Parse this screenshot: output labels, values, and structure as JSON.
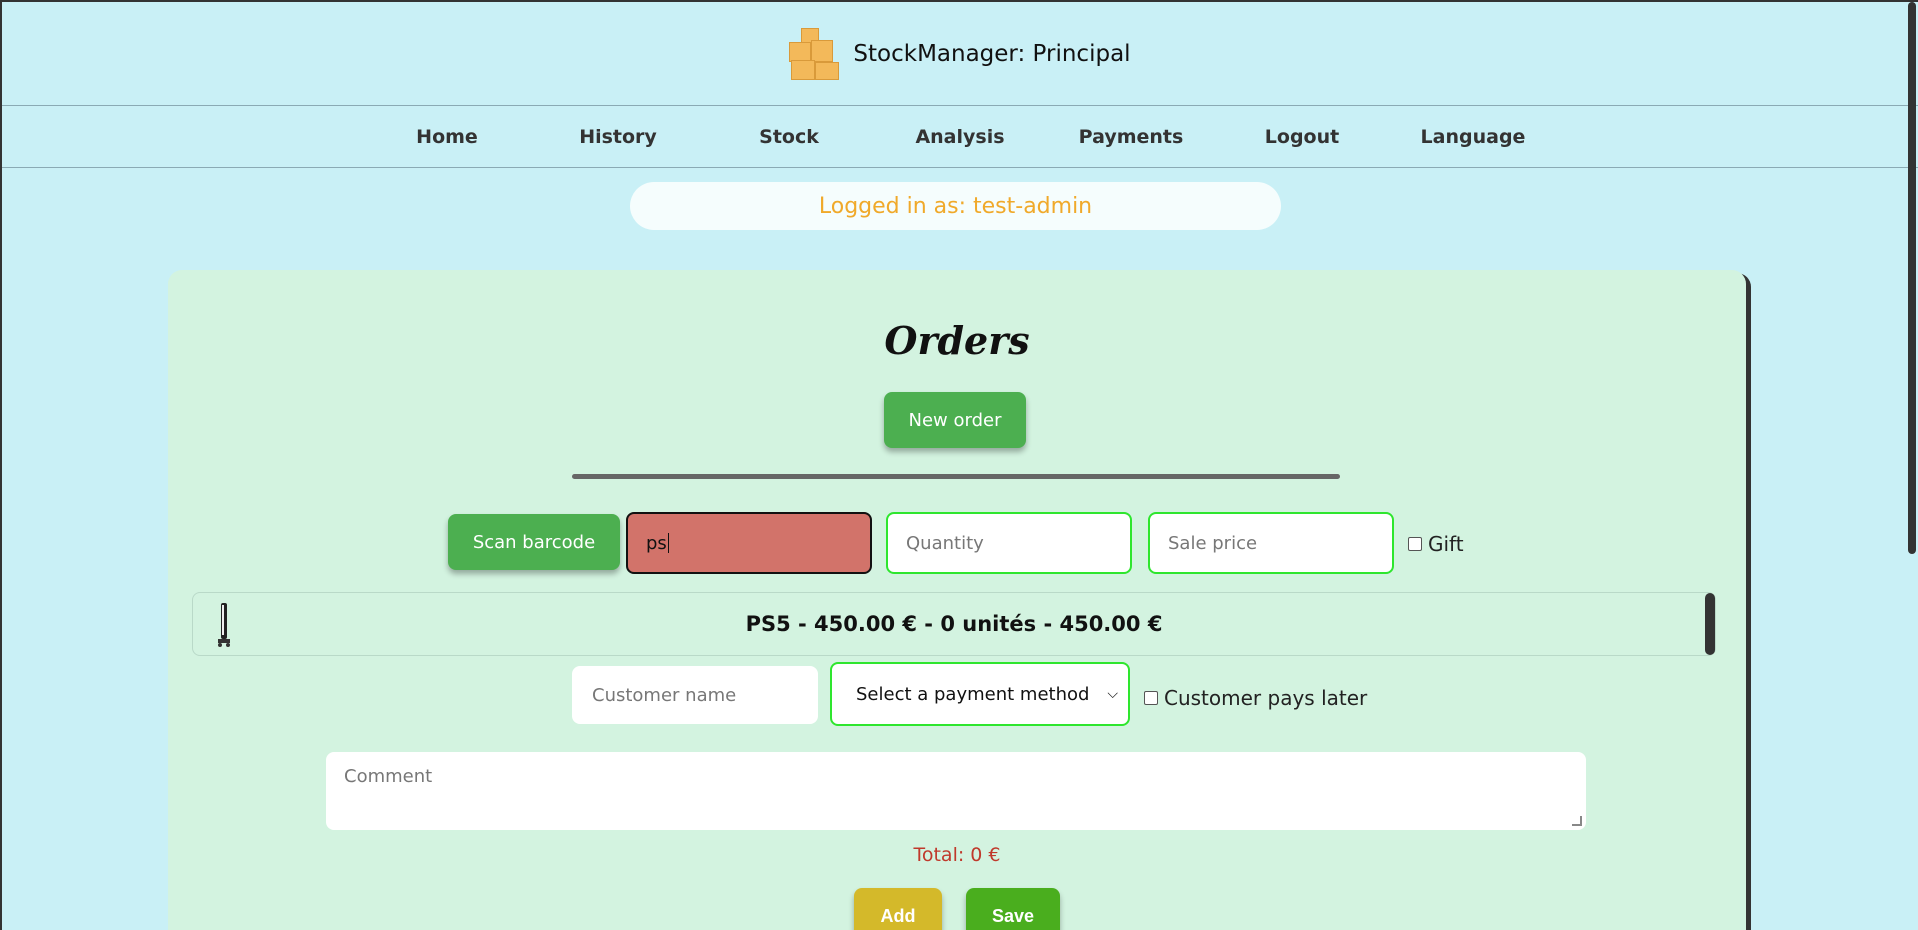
{
  "header": {
    "title": "StockManager: Principal",
    "logo_icon": "boxes-icon"
  },
  "nav": {
    "items": [
      "Home",
      "History",
      "Stock",
      "Analysis",
      "Payments",
      "Logout",
      "Language"
    ]
  },
  "session": {
    "logged_in_text": "Logged in as: test-admin"
  },
  "orders": {
    "title": "Orders",
    "new_order_label": "New order",
    "scan_barcode_label": "Scan barcode",
    "search_value": "ps",
    "quantity_placeholder": "Quantity",
    "sale_price_placeholder": "Sale price",
    "gift_label": "Gift",
    "product_result": "PS5 - 450.00 € - 0 unités - 450.00 €",
    "customer_name_placeholder": "Customer name",
    "payment_method_selected": "Select a payment method",
    "customer_pays_later_label": "Customer pays later",
    "comment_placeholder": "Comment",
    "total_text": "Total: 0 €",
    "add_label": "Add",
    "save_label": "Save"
  },
  "colors": {
    "background": "#c9f0f6",
    "card": "#d3f3e0",
    "primary_green": "#4caf50",
    "login_text": "#f0a92a",
    "search_invalid": "#d2736a",
    "total_text": "#c0392b",
    "add_button": "#d4b92a",
    "save_button": "#4aae1e"
  }
}
